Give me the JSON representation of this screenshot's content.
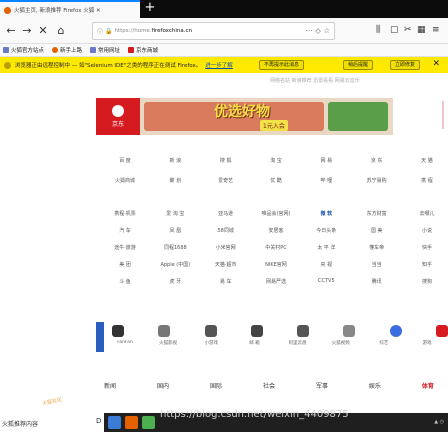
{
  "browser": {
    "tab": {
      "title": "火狐主页, 新浪推荐 Firefox 火狐 ✕"
    },
    "url": {
      "prefix": "https://home.",
      "host": "firefoxchina.cn"
    },
    "bookmarks": [
      "火狐官方站点",
      "新手上路",
      "常用网址",
      "京东商城"
    ],
    "notification": {
      "text": "浏览器正由远程控制中 — 如\"Selenium IDE\"之类的程序正在测试 Firefox。",
      "link": "进一步了解",
      "buttons": [
        "不再提示此消息",
        "稍后提醒",
        "立即修复"
      ]
    }
  },
  "page": {
    "topline": "网络名站  新浪推荐  迅雷看看  网易云音乐",
    "banner": {
      "logo": "京东",
      "big": "优选好物",
      "tag": "1元入会"
    },
    "category_rows": [
      [
        "百  度",
        "新 浪",
        "搜 狐",
        "淘 宝",
        "网 易",
        "京 东",
        "天 猫"
      ],
      [
        "火狐商城",
        "聚 划",
        "爱奇艺",
        "优 酷",
        "哔 哩",
        "苏宁易购",
        "携 程"
      ],
      [
        "",
        "",
        "",
        "",
        "",
        "",
        ""
      ],
      [
        "携程·机票",
        "爱 淘 宝",
        "亚马逊",
        "唯品会(官网)",
        "微 软",
        "东方财富",
        "去哪儿"
      ],
      [
        "汽 车",
        "凤 凰",
        "58同城",
        "安居客",
        "今日头条",
        "国 美",
        "小说"
      ],
      [
        "途牛·旅游",
        "同程1688",
        "小米官网",
        "中关村PC",
        "太 平 洋",
        "懂车帝",
        "快手"
      ],
      [
        "美 团",
        "Apple (中国)",
        "天猫·超市",
        "NIKE官网",
        "央 视",
        "当当",
        "知乎"
      ],
      [
        "斗 鱼",
        "虎 牙",
        "易 车",
        "网易严选",
        "CCTV5",
        "腾讯",
        "搜狗"
      ]
    ],
    "strip_labels": [
      "FanFan",
      "火狐影视",
      "小游戏",
      "邮 箱",
      "阿里云盘",
      "火狐视频",
      "综艺",
      "游戏"
    ],
    "bottom_tabs": [
      "新闻",
      "国内",
      "国际",
      "社会",
      "军事",
      "娱乐",
      "体育"
    ],
    "active_bottom_tab": "体育",
    "corner_logo": "火狐社区",
    "corner_text": "火狐推荐内容",
    "taskbar_watermark": "https://blog.csdn.net/weixin_4409875"
  }
}
